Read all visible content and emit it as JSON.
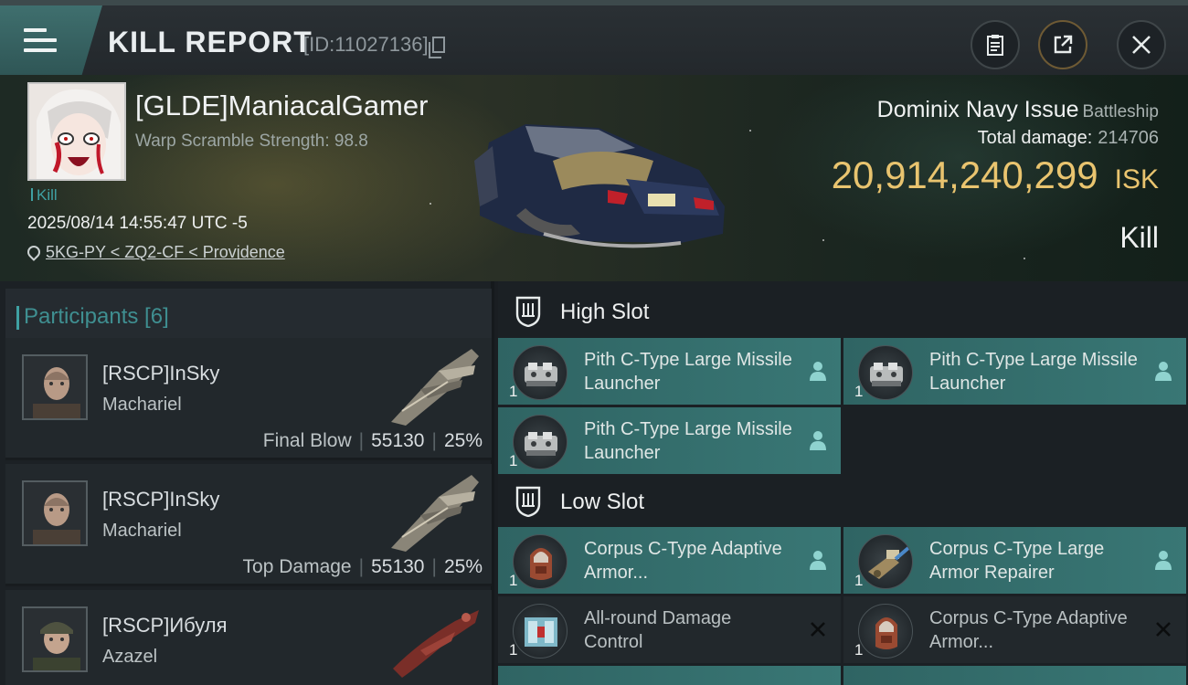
{
  "header": {
    "title": "KILL REPORT",
    "report_id": "[ID:11027136]"
  },
  "victim": {
    "pilot_name": "[GLDE]ManiacalGamer",
    "warp_scramble": "Warp Scramble Strength: 98.8",
    "kill_tag": "Kill",
    "datetime": "2025/08/14 14:55:47 UTC -5",
    "location": "5KG-PY < ZQ2-CF < Providence",
    "ship_name": "Dominix Navy Issue",
    "ship_type": "Battleship",
    "total_damage_label": "Total damage:",
    "total_damage": "214706",
    "isk_value": "20,914,240,299",
    "isk_unit": "ISK",
    "result": "Kill"
  },
  "participants": {
    "title": "Participants [6]",
    "list": [
      {
        "name": "[RSCP]InSky",
        "ship": "Machariel",
        "role": "Final Blow",
        "damage": "55130",
        "percent": "25%"
      },
      {
        "name": "[RSCP]InSky",
        "ship": "Machariel",
        "role": "Top Damage",
        "damage": "55130",
        "percent": "25%"
      },
      {
        "name": "[RSCP]Ибуля",
        "ship": "Azazel",
        "role": "",
        "damage": "",
        "percent": ""
      }
    ]
  },
  "fitting": {
    "high_slot": {
      "label": "High Slot",
      "modules": [
        {
          "name": "Pith C-Type Large Missile Launcher",
          "qty": "1",
          "state": "person-icon"
        },
        {
          "name": "Pith C-Type Large Missile Launcher",
          "qty": "1",
          "state": "person-icon"
        },
        {
          "name": "Pith C-Type Large Missile Launcher",
          "qty": "1",
          "state": "person-icon"
        }
      ]
    },
    "low_slot": {
      "label": "Low Slot",
      "modules": [
        {
          "name": "Corpus C-Type Adaptive Armor...",
          "qty": "1",
          "state": "person-icon"
        },
        {
          "name": "Corpus C-Type Large Armor Repairer",
          "qty": "1",
          "state": "person-icon"
        },
        {
          "name": "All-round Damage Control",
          "qty": "1",
          "state": "destroyed-icon"
        },
        {
          "name": "Corpus C-Type Adaptive Armor...",
          "qty": "1",
          "state": "destroyed-icon"
        }
      ]
    }
  },
  "colors": {
    "accent": "#3fa1a3",
    "isk": "#e9c46f",
    "module_dropped": "#397775"
  }
}
